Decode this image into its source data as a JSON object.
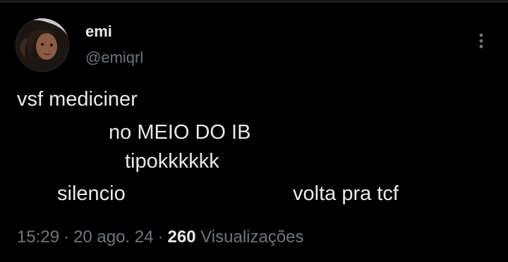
{
  "author": {
    "display_name": "emi",
    "handle": "@emiqrl"
  },
  "tweet": {
    "lines": [
      "vsf mediciner",
      "no MEIO DO IB",
      "tipokkkkkk",
      "silencio",
      "volta pra tcf"
    ]
  },
  "meta": {
    "time": "15:29",
    "separator": "·",
    "date": "20 ago. 24",
    "views_count": "260",
    "views_label": "Visualizações"
  },
  "icons": {
    "more": "more-vertical-icon"
  },
  "colors": {
    "background": "#000000",
    "text": "#e7e9ea",
    "muted": "#71767b"
  }
}
